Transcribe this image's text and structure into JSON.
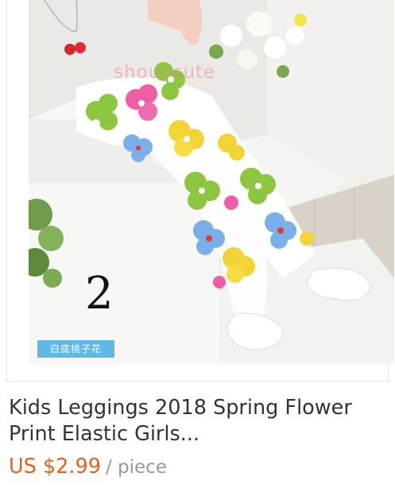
{
  "product": {
    "watermark": "shouvcute",
    "variant_number": "2",
    "variant_tag": "白底桃子花",
    "title_line1": "Kids Leggings 2018 Spring Flower",
    "title_line2": "Print Elastic Girls...",
    "price": "US $2.99",
    "unit": "/ piece"
  },
  "colors": {
    "price": "#e5621d",
    "title": "#333333",
    "unit": "#999999",
    "tag_background": "#5fb9e6"
  }
}
